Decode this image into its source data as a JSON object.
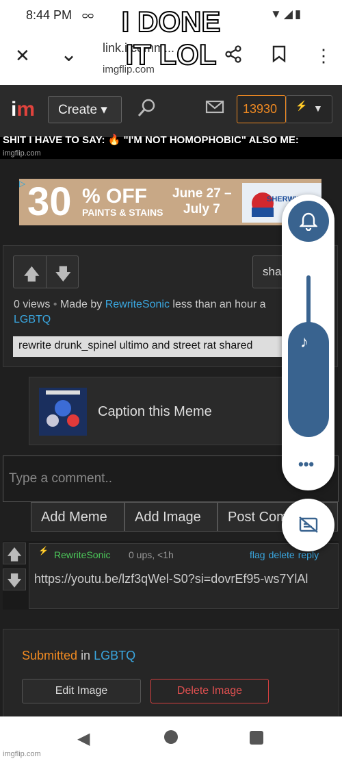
{
  "status": {
    "time": "8:44 PM",
    "voicemail_icon": "voicemail-icon",
    "icons": "wifi-icon signal-icon battery-icon"
  },
  "browser": {
    "title": "link.i.comm...",
    "host": "imgflip.com",
    "close": "✕",
    "collapse": "⌄",
    "share": "share-icon",
    "bookmark": "bookmark-icon",
    "menu": "⋮"
  },
  "overlay": {
    "caption_line1": "I DONE",
    "caption_line2": "IT LOL"
  },
  "nav": {
    "logo_i": "i",
    "logo_m": "m",
    "create": "Create ▾",
    "points": "13930",
    "accent": "#f08a22"
  },
  "meme": {
    "text_prefix": "SHIT I HAVE TO SAY:",
    "text_quote": "\"I'M NOT HOMOPHOBIC\" ALSO ME:",
    "credit": "imgflip.com"
  },
  "ad": {
    "big": "30",
    "off": "% OFF",
    "sub": "PAINTS & STAINS",
    "date1": "June 27 –",
    "date2": "July 7",
    "brand": "SHERWIN WIL"
  },
  "info": {
    "share": "sha",
    "views": "0 views",
    "dot": "•",
    "made_by": "Made by",
    "user": "RewriteSonic",
    "time": "less than an hour a",
    "stream": "LGBTQ",
    "tags": "rewrite drunk_spinel ultimo and street rat shared"
  },
  "caption": {
    "label": "Caption this Meme"
  },
  "comment_form": {
    "placeholder": "Type a comment..",
    "add_meme": "Add Meme",
    "add_image": "Add Image",
    "post": "Post Comment"
  },
  "comment": {
    "user": "RewriteSonic",
    "meta": "0 ups, <1h",
    "flag": "flag",
    "delete": "delete",
    "reply": "reply",
    "text": "https://youtu.be/lzf3qWel-S0?si=dovrEf95-ws7YlAl"
  },
  "submitted": {
    "label": "Submitted",
    "in": "in",
    "stream": "LGBTQ",
    "edit": "Edit Image",
    "delete": "Delete Image"
  },
  "watermark": "imgflip.com"
}
